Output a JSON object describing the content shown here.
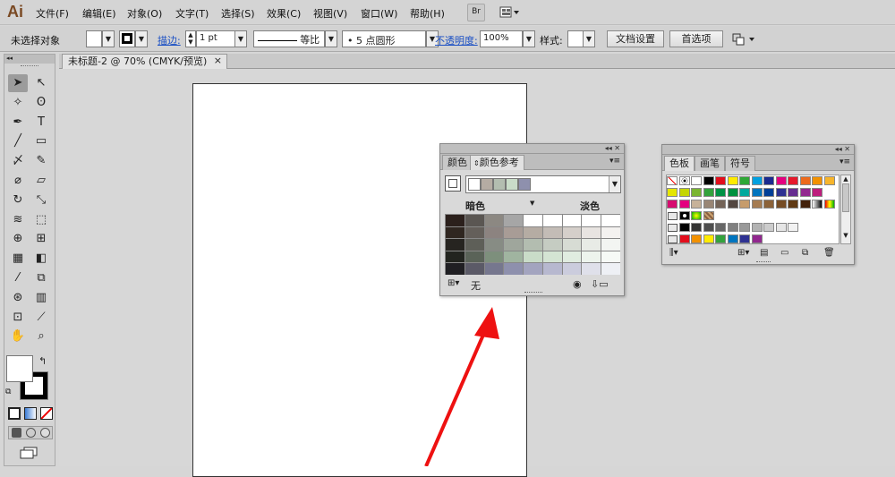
{
  "app": {
    "logo": "Ai",
    "bridge_label": "Br",
    "arrange_icon": "arrange-documents-icon"
  },
  "menu": [
    "文件(F)",
    "编辑(E)",
    "对象(O)",
    "文字(T)",
    "选择(S)",
    "效果(C)",
    "视图(V)",
    "窗口(W)",
    "帮助(H)"
  ],
  "control": {
    "selection_status": "未选择对象",
    "stroke_label": "描边:",
    "stroke_weight": "1 pt",
    "stroke_profile": "等比",
    "brush": "5 点圆形",
    "opacity_label": "不透明度:",
    "opacity_value": "100%",
    "style_label": "样式:",
    "doc_setup_button": "文档设置",
    "preferences_button": "首选项"
  },
  "document": {
    "tab_title": "未标题-2 @ 70% (CMYK/预览)",
    "close": "×"
  },
  "color_guide": {
    "tab_color": "颜色",
    "tab_guide": "颜色参考",
    "darker": "暗色",
    "lighter": "淡色",
    "none_label": "无",
    "harmony": [
      "#ffffff",
      "#b5aca3",
      "#b3bdb0",
      "#c9dcc8",
      "#8e90ad"
    ],
    "grid": [
      [
        "#2b201c",
        "#5a5652",
        "#8c8882",
        "#a6a6a6",
        "#ffffff",
        "#ffffff",
        "#ffffff",
        "#ffffff",
        "#ffffff"
      ],
      [
        "#2f2620",
        "#645f5a",
        "#8c8380",
        "#a89c96",
        "#b5aca3",
        "#c3bcb6",
        "#d5cfca",
        "#e8e4e1",
        "#f4f2f0"
      ],
      [
        "#262420",
        "#5e5f58",
        "#878c84",
        "#9fa69c",
        "#b3bdb0",
        "#c5ccc2",
        "#d7dcd4",
        "#e8ebe6",
        "#f3f5f2"
      ],
      [
        "#22241f",
        "#5a6358",
        "#7d8f7c",
        "#a0b4a0",
        "#c9dcc8",
        "#d4e4d3",
        "#e0ece0",
        "#edf4ed",
        "#f6faf6"
      ],
      [
        "#201f23",
        "#5b5a67",
        "#76778e",
        "#8e90ad",
        "#a3a4bf",
        "#b7b8cf",
        "#cbccdd",
        "#dfe0ea",
        "#eef0f5"
      ]
    ]
  },
  "swatches": {
    "tab_swatches": "色板",
    "tab_brushes": "画笔",
    "tab_symbols": "符号",
    "rows": [
      [
        "none",
        "reg",
        "#ffffff",
        "#000000",
        "#e30e1c",
        "#ffeb00",
        "#2fa836",
        "#00a0e0",
        "#1b2a8f",
        "#e4007f",
        "#e6192b",
        "#ec6a1c",
        "#f29100",
        "#f7b52c"
      ],
      [
        "#e5e600",
        "#c4d600",
        "#7ab531",
        "#33a23d",
        "#009245",
        "#00923f",
        "#00a99d",
        "#0075bf",
        "#003f98",
        "#2e3192",
        "#662d91",
        "#92278f",
        "#be1e7d"
      ],
      [
        "#d60c6f",
        "#e4007f",
        "#c7b299",
        "#998675",
        "#736357",
        "#534741",
        "#c69c6c",
        "#a57c52",
        "#8b6239",
        "#754c24",
        "#603913",
        "#42210b",
        "grad1",
        "grad2"
      ],
      [
        "pattern",
        "grad3",
        "grad4"
      ],
      [
        "#000000",
        "#333333",
        "#4d4d4d",
        "#666666",
        "#808080",
        "#999999",
        "#b3b3b3",
        "#cccccc",
        "#e6e6e6",
        "#f2f2f2"
      ],
      [
        "#e30e1c",
        "#f29100",
        "#ffeb00",
        "#33a23d",
        "#0075bf",
        "#2e3192",
        "#92278f"
      ]
    ]
  }
}
